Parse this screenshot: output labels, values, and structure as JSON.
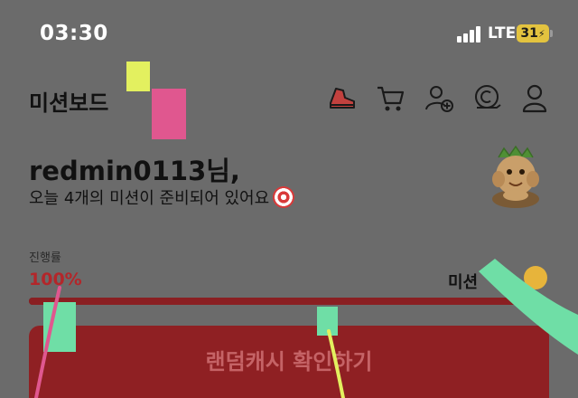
{
  "status_bar": {
    "time": "03:30",
    "network": "LTE",
    "battery": "31"
  },
  "header": {
    "title": "미션보드",
    "icons": [
      "sneaker-icon",
      "cart-icon",
      "add-friend-icon",
      "coin-stack-icon",
      "profile-icon"
    ]
  },
  "greeting": {
    "name_line": "redmin0113님,",
    "subtitle": "오늘 4개의 미션이 준비되어 있어요"
  },
  "progress": {
    "label": "진행률",
    "percent_text": "100%",
    "value": 1.0,
    "mission_link": "미션"
  },
  "cta": {
    "label": "랜덤캐시 확인하기"
  },
  "colors": {
    "accent": "#b3262a",
    "button": "#8f2023",
    "overlay_dim": "#6b6b6b",
    "sticker_yellow": "#e3f05f",
    "sticker_pink": "#e0578f",
    "sticker_green": "#6fdea6"
  }
}
